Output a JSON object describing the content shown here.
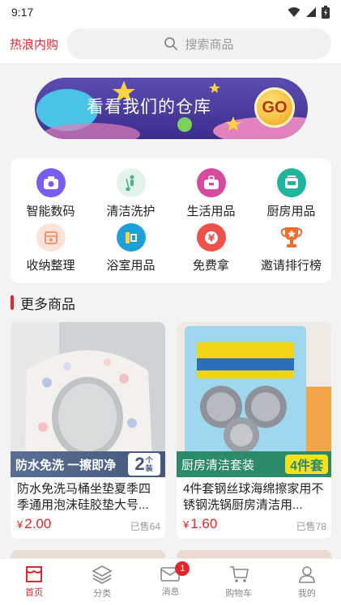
{
  "status": {
    "time": "9:17"
  },
  "header": {
    "brand": "热浪内购",
    "search_placeholder": "搜索商品"
  },
  "banner": {
    "text": "看看我们的仓库",
    "go_label": "GO"
  },
  "categories": [
    {
      "label": "智能数码",
      "icon": "camera-icon",
      "color": "#7b5cf0"
    },
    {
      "label": "清洁洗护",
      "icon": "broom-icon",
      "color": "#4fb38a"
    },
    {
      "label": "生活用品",
      "icon": "toolbox-icon",
      "color": "#d84aa0"
    },
    {
      "label": "厨房用品",
      "icon": "cooker-icon",
      "color": "#1fb59c"
    },
    {
      "label": "收纳整理",
      "icon": "storage-box-icon",
      "color": "#f08a64"
    },
    {
      "label": "浴室用品",
      "icon": "bath-icon",
      "color": "#1d9fd8"
    },
    {
      "label": "免费拿",
      "icon": "yen-coin-icon",
      "color": "#f0504a"
    },
    {
      "label": "邀请排行榜",
      "icon": "trophy-icon",
      "color": "#f06a2a"
    }
  ],
  "section": {
    "title": "更多商品"
  },
  "products": [
    {
      "tag": "防水免洗 一擦即净",
      "tag_badge_num": "2",
      "tag_badge_text": "个装",
      "title": "防水免洗马桶坐垫夏季四季通用泡沫硅胶垫大号...",
      "currency": "¥",
      "price": "2.00",
      "sold": "已售64"
    },
    {
      "tag": "厨房清洁套装",
      "tag_badge_text": "4件套",
      "title": "4件套钢丝球海绵擦家用不锈钢洗锅厨房清洁用...",
      "currency": "¥",
      "price": "1.60",
      "sold": "已售78"
    }
  ],
  "tabbar": {
    "items": [
      {
        "label": "首页",
        "icon": "home-icon",
        "active": true
      },
      {
        "label": "分类",
        "icon": "layers-icon"
      },
      {
        "label": "消息",
        "icon": "mail-icon",
        "badge": "1"
      },
      {
        "label": "购物车",
        "icon": "cart-icon"
      },
      {
        "label": "我的",
        "icon": "user-icon"
      }
    ]
  },
  "colors": {
    "accent": "#e3262d"
  }
}
